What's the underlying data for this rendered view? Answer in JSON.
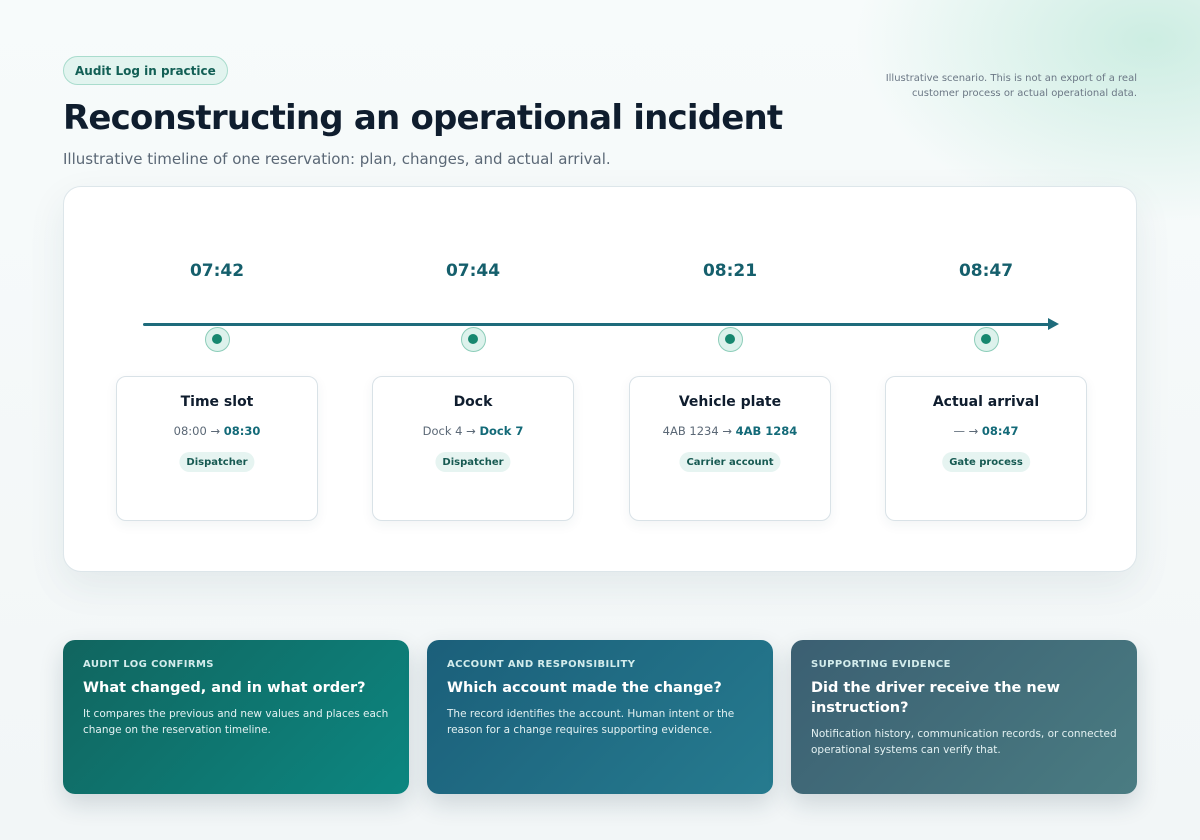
{
  "header": {
    "badge": "Audit Log in practice",
    "title": "Reconstructing an operational incident",
    "subtitle": "Illustrative timeline of one reservation: plan, changes, and actual arrival.",
    "disclaimer": "Illustrative scenario. This is not an export of a real customer process or actual operational data."
  },
  "timeline": {
    "events": [
      {
        "time": "07:42",
        "label": "Time slot",
        "old": "08:00",
        "arrow": "→",
        "new": "08:30",
        "actor": "Dispatcher"
      },
      {
        "time": "07:44",
        "label": "Dock",
        "old": "Dock 4",
        "arrow": "→",
        "new": "Dock 7",
        "actor": "Dispatcher"
      },
      {
        "time": "08:21",
        "label": "Vehicle plate",
        "old": "4AB 1234",
        "arrow": "→",
        "new": "4AB 1284",
        "actor": "Carrier account"
      },
      {
        "time": "08:47",
        "label": "Actual arrival",
        "old": "—",
        "arrow": "→",
        "new": "08:47",
        "actor": "Gate process"
      }
    ]
  },
  "cards": [
    {
      "kicker": "AUDIT LOG CONFIRMS",
      "question": "What changed, and in what order?",
      "body": "It compares the previous and new values and places each change on the reservation timeline.",
      "color": "#0c7a73"
    },
    {
      "kicker": "ACCOUNT AND RESPONSIBILITY",
      "question": "Which account made the change?",
      "body": "The record identifies the account. Human intent or the reason for a change requires supporting evidence.",
      "color": "#1e6d85"
    },
    {
      "kicker": "SUPPORTING EVIDENCE",
      "question": "Did the driver receive the new instruction?",
      "body": "Notification history, communication records, or connected operational systems can verify that.",
      "color": "#426e79"
    }
  ]
}
